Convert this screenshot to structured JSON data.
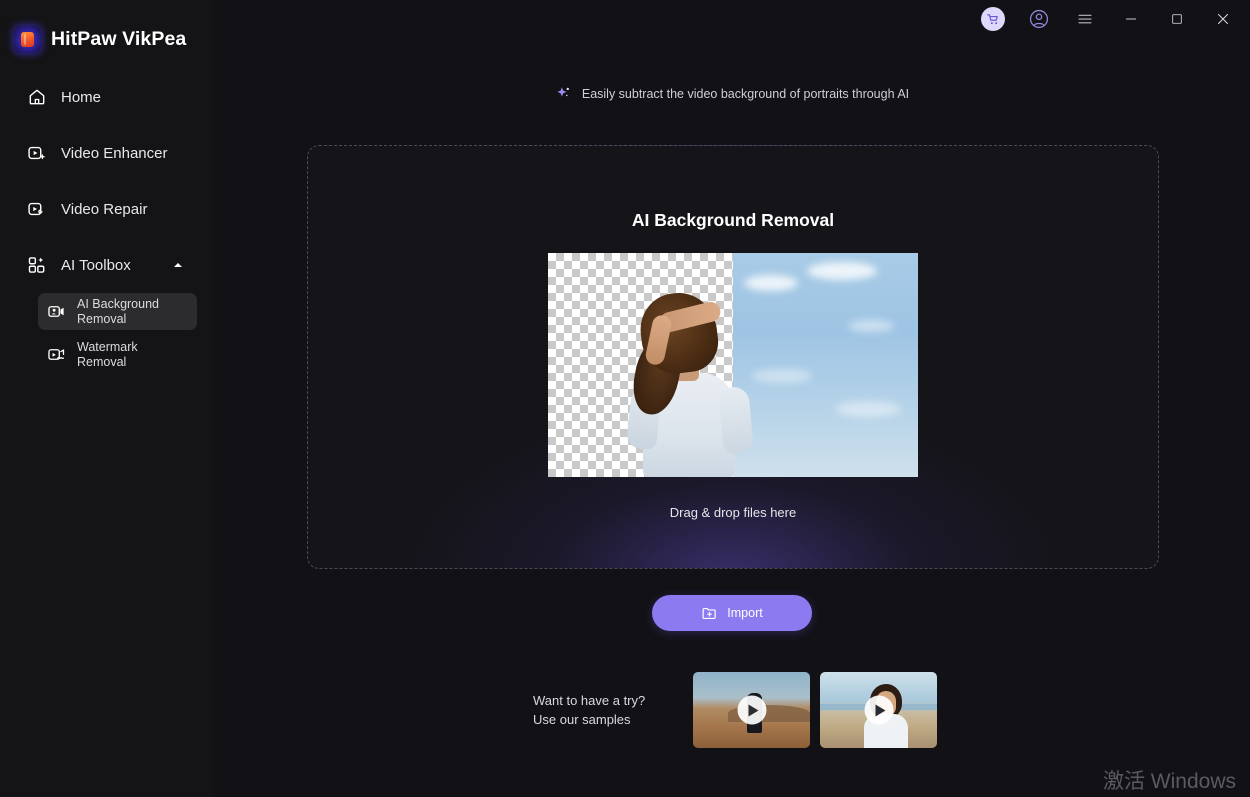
{
  "app": {
    "brand_name": "HitPaw VikPea",
    "logo_icon": "hitpaw-logo-icon",
    "accent_color": "#8b7af0",
    "background_color": "#121115",
    "sidebar_color": "#141416"
  },
  "titlebar": {
    "buttons": [
      {
        "name": "cart-button",
        "icon": "shopping-cart-icon"
      },
      {
        "name": "account-button",
        "icon": "user-account-icon"
      },
      {
        "name": "menu-button",
        "icon": "hamburger-menu-icon"
      },
      {
        "name": "minimize-button",
        "icon": "minimize-icon"
      },
      {
        "name": "maximize-button",
        "icon": "maximize-icon"
      },
      {
        "name": "close-button",
        "icon": "close-icon"
      }
    ]
  },
  "sidebar": {
    "items": [
      {
        "label": "Home",
        "icon": "home-icon",
        "active": false,
        "expandable": false
      },
      {
        "label": "Video Enhancer",
        "icon": "video-enhance-icon",
        "active": false,
        "expandable": false
      },
      {
        "label": "Video Repair",
        "icon": "video-repair-icon",
        "active": false,
        "expandable": false
      },
      {
        "label": "AI Toolbox",
        "icon": "ai-toolbox-icon",
        "active": false,
        "expandable": true,
        "expanded": true,
        "chevron": "chevron-up-icon"
      }
    ],
    "submenu": [
      {
        "label": "AI Background Removal",
        "icon": "background-removal-icon",
        "active": true
      },
      {
        "label": "Watermark Removal",
        "icon": "watermark-removal-icon",
        "active": false
      }
    ]
  },
  "main": {
    "subtitle": "Easily subtract the video background of portraits through AI",
    "subtitle_icon": "sparkle-icon",
    "card": {
      "title": "AI Background Removal",
      "drop_hint": "Drag & drop files here",
      "preview_left_label": "transparent-checkerboard-result",
      "preview_right_label": "original-sky-background"
    },
    "import_button": {
      "label": "Import",
      "icon": "folder-add-icon"
    },
    "samples": {
      "text_line1": "Want to have a try?",
      "text_line2": "Use our samples",
      "items": [
        {
          "name": "sample-video-desert",
          "play_icon": "play-icon"
        },
        {
          "name": "sample-video-beach-portrait",
          "play_icon": "play-icon"
        }
      ]
    }
  },
  "watermark": {
    "text": "激活 Windows"
  }
}
